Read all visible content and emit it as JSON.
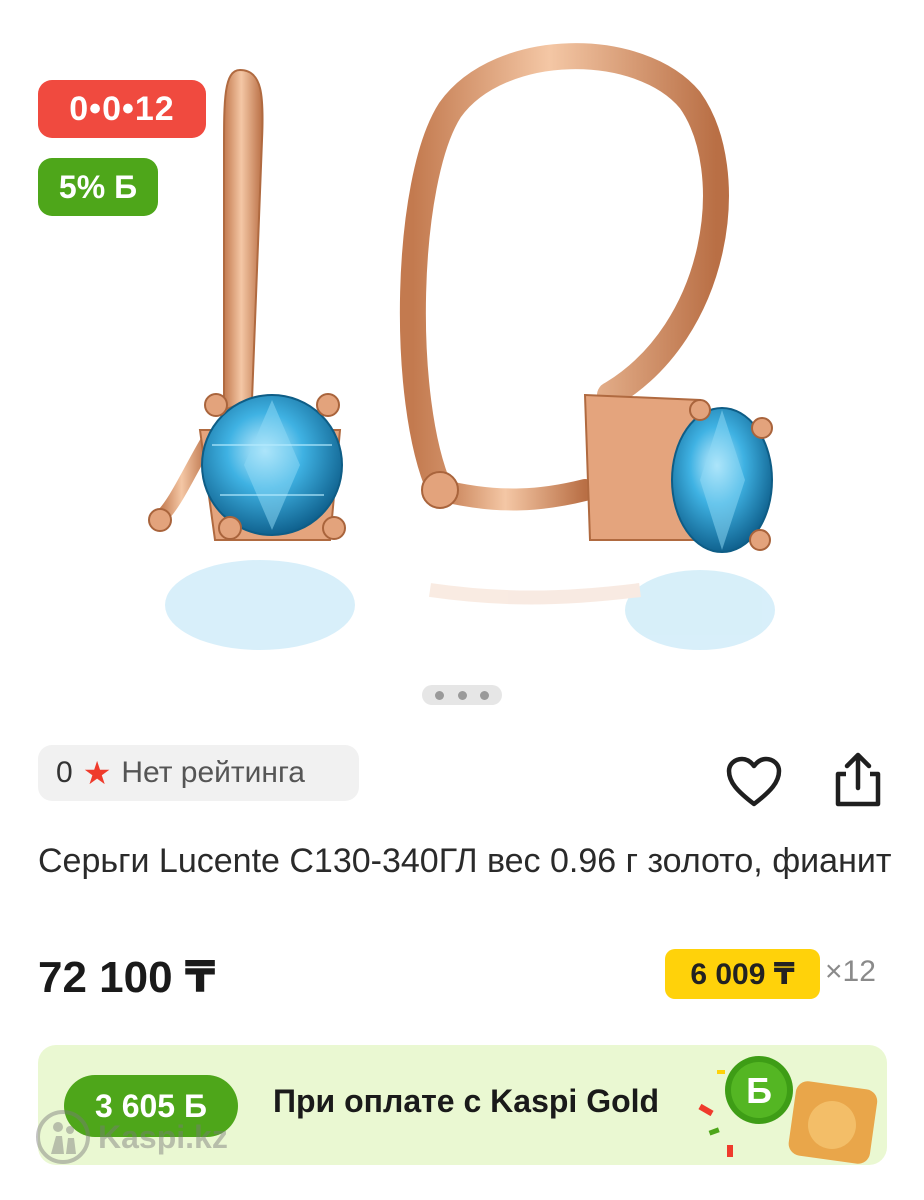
{
  "gallery": {
    "installment_badge": "0•0•12",
    "bonus_badge": "5% Б",
    "pager": {
      "count": 3,
      "active_index": 0
    }
  },
  "rating": {
    "count": "0",
    "label": "Нет рейтинга"
  },
  "actions": {
    "favorite_icon": "heart-icon",
    "share_icon": "share-icon"
  },
  "product": {
    "title": "Серьги Lucente С130-340ГЛ вес 0.96 г золото, фианит",
    "price": "72 100 ₸",
    "monthly_payment": "6 009 ₸",
    "installment_multiplier": "×12"
  },
  "kaspi_gold": {
    "bonus": "3 605 Б",
    "text": "При оплате с Kaspi Gold"
  },
  "watermark": "Kaspi.kz",
  "colors": {
    "installment_red": "#f04a3f",
    "bonus_green": "#4ea61a",
    "price_yellow": "#ffd20a",
    "banner_bg": "#eaf8d2",
    "gold": "#d9976b",
    "stone_blue": "#2aa3d6"
  }
}
